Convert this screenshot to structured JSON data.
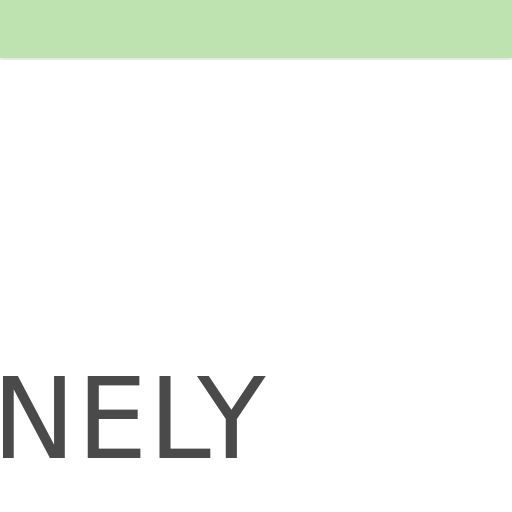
{
  "header": {
    "bar_color": "#bfe3b0"
  },
  "main": {
    "headline": "NELY",
    "headline_color": "#4a4a4a"
  }
}
